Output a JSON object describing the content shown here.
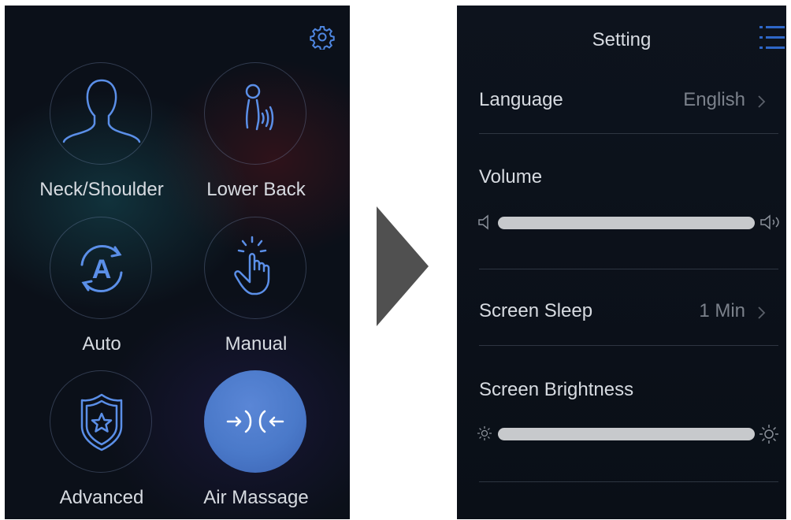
{
  "left_panel": {
    "modes": [
      {
        "label": "Neck/Shoulder",
        "icon": "neck-shoulder-icon",
        "active": false
      },
      {
        "label": "Lower Back",
        "icon": "lower-back-icon",
        "active": false
      },
      {
        "label": "Auto",
        "icon": "auto-icon",
        "active": false,
        "icon_letter": "A"
      },
      {
        "label": "Manual",
        "icon": "manual-icon",
        "active": false
      },
      {
        "label": "Advanced",
        "icon": "advanced-icon",
        "active": false
      },
      {
        "label": "Air Massage",
        "icon": "air-massage-icon",
        "active": true
      }
    ],
    "settings_icon": "gear-icon",
    "active_color": "#4a79c9"
  },
  "right_panel": {
    "title": "Setting",
    "menu_icon": "menu-list-icon",
    "language": {
      "label": "Language",
      "value": "English"
    },
    "volume": {
      "label": "Volume",
      "level": 1.0
    },
    "screen_sleep": {
      "label": "Screen Sleep",
      "value": "1 Min"
    },
    "screen_brightness": {
      "label": "Screen Brightness",
      "level": 1.0
    },
    "accent_color": "#2e67c8"
  }
}
